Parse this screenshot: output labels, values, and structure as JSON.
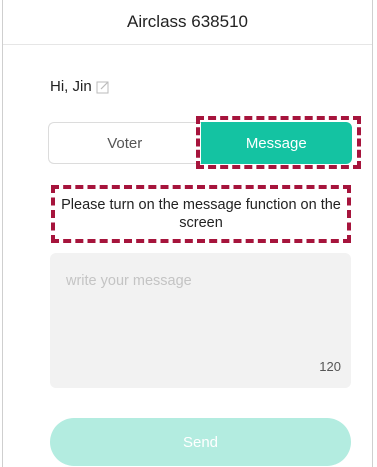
{
  "header": {
    "title": "Airclass 638510"
  },
  "greeting": {
    "text": "Hi, Jin",
    "icon": "edit-icon"
  },
  "tabs": [
    {
      "label": "Voter",
      "active": false
    },
    {
      "label": "Message",
      "active": true
    }
  ],
  "notice": {
    "text": "Please turn on the message function on the screen"
  },
  "message": {
    "placeholder": "write your message",
    "char_count": "120"
  },
  "send": {
    "label": "Send"
  },
  "colors": {
    "accent": "#14c3a2",
    "accent_disabled": "#b3ece0",
    "highlight": "#a6143c"
  }
}
